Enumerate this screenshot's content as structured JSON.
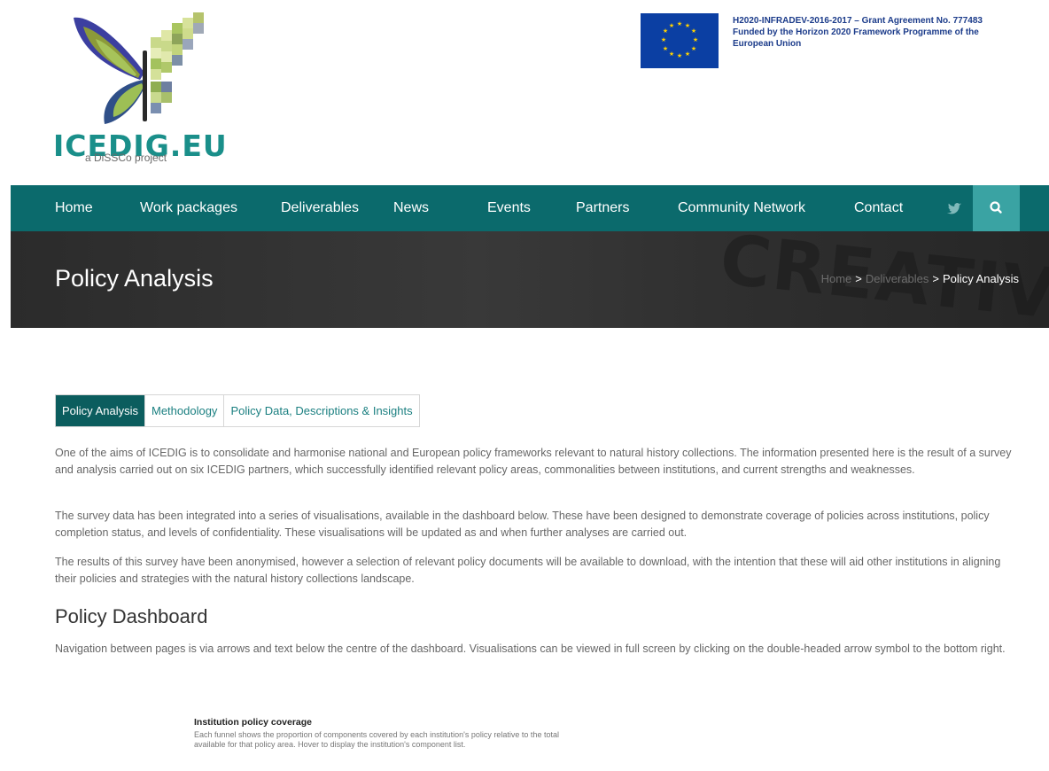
{
  "logo": {
    "wordmark": "ICEDIG.EU",
    "tagline": "a DiSSCo project"
  },
  "grant": {
    "line1": "H2020-INFRADEV-2016-2017 – Grant Agreement No. 777483",
    "line2": "Funded by the Horizon 2020 Framework Programme of the",
    "line3": "European Union"
  },
  "nav": {
    "items": [
      "Home",
      "Work packages",
      "Deliverables",
      "News",
      "Events",
      "Partners",
      "Community Network",
      "Contact"
    ],
    "twitter_icon": "twitter-icon",
    "search_icon": "search-icon"
  },
  "banner": {
    "title": "Policy Analysis",
    "breadcrumb": {
      "home": "Home",
      "sep": ">",
      "deliverables": "Deliverables",
      "current": "Policy Analysis"
    }
  },
  "tabs": [
    "Policy Analysis",
    "Methodology",
    "Policy Data, Descriptions & Insights"
  ],
  "content": {
    "p1": "One of the aims of ICEDIG is to consolidate and harmonise national and European policy frameworks relevant to natural history collections. The information presented here is the result of a survey and analysis carried out on six ICEDIG partners, which successfully identified relevant policy areas, commonalities between institutions, and current strengths and weaknesses.",
    "p2": "The survey data has been integrated into a series of visualisations, available in the dashboard below. These have been designed to demonstrate coverage of policies across institutions, policy completion status, and levels of confidentiality. These visualisations will be updated as and when further analyses are carried out.",
    "p3": "The results of this survey have been anonymised, however a selection of relevant policy documents will be available to download, with the intention that these will aid other institutions in aligning their policies and strategies with the natural history collections landscape.",
    "section_title": "Policy Dashboard",
    "p4": "Navigation between pages is via arrows and text below the centre of the dashboard. Visualisations can be viewed in full screen by clicking on the double-headed arrow symbol to the bottom right."
  },
  "dashboard": {
    "title": "Institution policy coverage",
    "description": "Each funnel shows the proportion of components covered by each institution's policy relative to the total available for that policy area. Hover to display the institution's component list."
  },
  "colors": {
    "nav_bg": "#0b6a6c",
    "accent": "#3aa3a3",
    "tab_active": "#0b5d5e",
    "eu_blue": "#0b3fa3",
    "eu_star": "#ffd200"
  }
}
